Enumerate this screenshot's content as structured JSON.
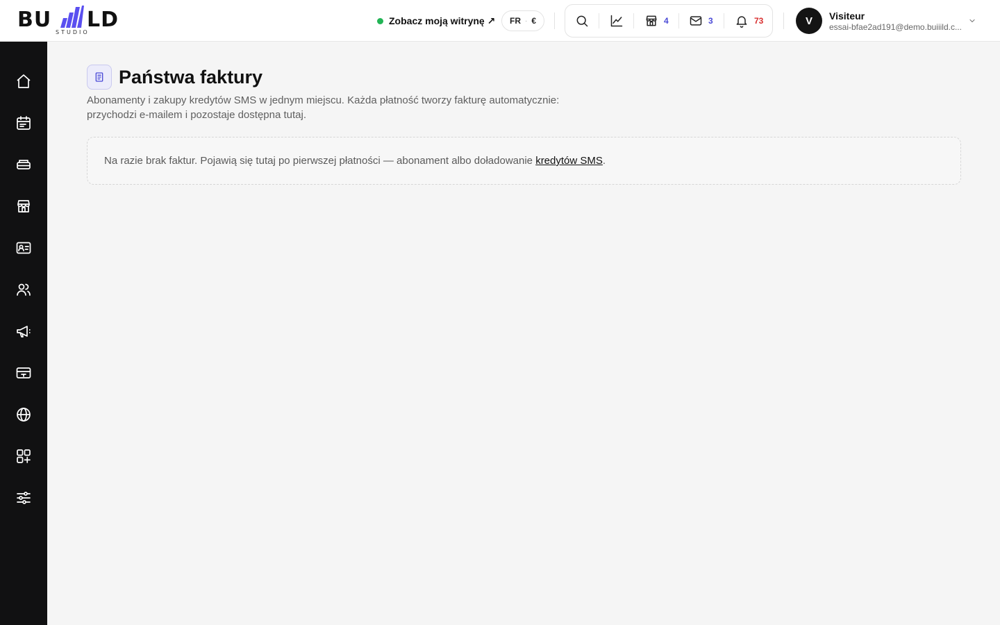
{
  "logo": {
    "word_left": "BU",
    "word_right": "LD",
    "sub": "STUDIO",
    "bar_color": "#5a4ff0"
  },
  "header": {
    "site_link_label": "Zobacz moją witrynę ↗",
    "locale": {
      "language": "FR",
      "separator": "·",
      "currency": "€"
    },
    "tools": [
      {
        "name": "search-icon",
        "count": null
      },
      {
        "name": "analytics-icon",
        "count": null
      },
      {
        "name": "store-icon",
        "count": "4"
      },
      {
        "name": "mail-icon",
        "count": "3"
      },
      {
        "name": "bell-icon",
        "count": "73"
      }
    ],
    "user": {
      "initial": "V",
      "name": "Visiteur",
      "email": "essai-bfae2ad191@demo.buiiild.c..."
    }
  },
  "sidebar": {
    "items": [
      {
        "icon": "home-icon"
      },
      {
        "icon": "calendar-icon"
      },
      {
        "icon": "services-icon"
      },
      {
        "icon": "shop-icon"
      },
      {
        "icon": "contact-card-icon"
      },
      {
        "icon": "users-icon"
      },
      {
        "icon": "megaphone-icon"
      },
      {
        "icon": "payment-card-icon"
      },
      {
        "icon": "globe-icon"
      },
      {
        "icon": "apps-add-icon"
      },
      {
        "icon": "settings-sliders-icon"
      }
    ]
  },
  "page": {
    "title": "Państwa faktury",
    "description": "Abonamenty i zakupy kredytów SMS w jednym miejscu. Każda płatność tworzy fakturę automatycznie: przychodzi e-mailem i pozostaje dostępna tutaj.",
    "empty_text": "Na razie brak faktur. Pojawią się tutaj po pierwszej płatności — abonament albo doładowanie ",
    "empty_link": "kredytów SMS",
    "empty_end": "."
  },
  "colors": {
    "accent": "#5a4ff0",
    "count_blue": "#4a4ad6",
    "count_red": "#d93030",
    "live_dot": "#22b455",
    "sidebar_bg": "#111112"
  }
}
